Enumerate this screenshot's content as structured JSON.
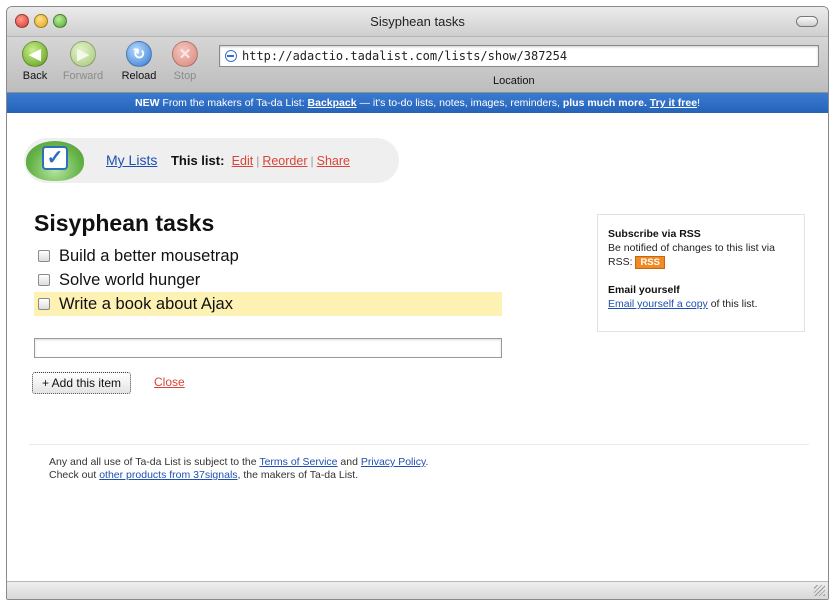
{
  "window": {
    "title": "Sisyphean tasks"
  },
  "toolbar": {
    "back_label": "Back",
    "forward_label": "Forward",
    "reload_label": "Reload",
    "stop_label": "Stop",
    "url": "http://adactio.tadalist.com/lists/show/387254",
    "location_label": "Location"
  },
  "banner": {
    "prefix": "NEW",
    "text1": " From the makers of Ta-da List: ",
    "backpack_link": "Backpack",
    "text2": " — it's to-do lists, notes, images, reminders, ",
    "bold": "plus much more.",
    "try_link": "Try it free",
    "suffix": "!"
  },
  "nav": {
    "my_lists": "My Lists",
    "this_list": "This list:",
    "edit": "Edit",
    "reorder": "Reorder",
    "share": "Share",
    "separator": "|"
  },
  "list": {
    "title": "Sisyphean tasks",
    "items": [
      {
        "label": "Build a better mousetrap",
        "highlighted": false
      },
      {
        "label": "Solve world hunger",
        "highlighted": false
      },
      {
        "label": "Write a book about Ajax",
        "highlighted": true
      }
    ],
    "new_item_value": "",
    "add_button": "+ Add this item",
    "close_link": "Close"
  },
  "sidebar": {
    "rss_heading": "Subscribe via RSS",
    "rss_text": "Be notified of changes to this list via RSS:",
    "rss_badge": "RSS",
    "email_heading": "Email yourself",
    "email_link": "Email yourself a copy",
    "email_suffix": " of this list."
  },
  "footer": {
    "line1_prefix": "Any and all use of Ta-da List is subject to the ",
    "tos_link": "Terms of Service",
    "and": " and ",
    "privacy_link": "Privacy Policy",
    "period": ".",
    "line2_prefix": "Check out ",
    "products_link": "other products from 37signals",
    "line2_suffix": ", the makers of Ta-da List."
  },
  "colors": {
    "banner_bg": "#2d6cc4",
    "link_blue": "#1e4fb3",
    "action_red": "#d9453a",
    "highlight_yellow": "#fdf2b4",
    "rss_orange": "#f08a24"
  },
  "icons": {
    "back": "back-arrow-icon",
    "forward": "forward-arrow-icon",
    "reload": "reload-icon",
    "stop": "stop-x-icon",
    "logo": "tadalist-checkmark-logo"
  }
}
